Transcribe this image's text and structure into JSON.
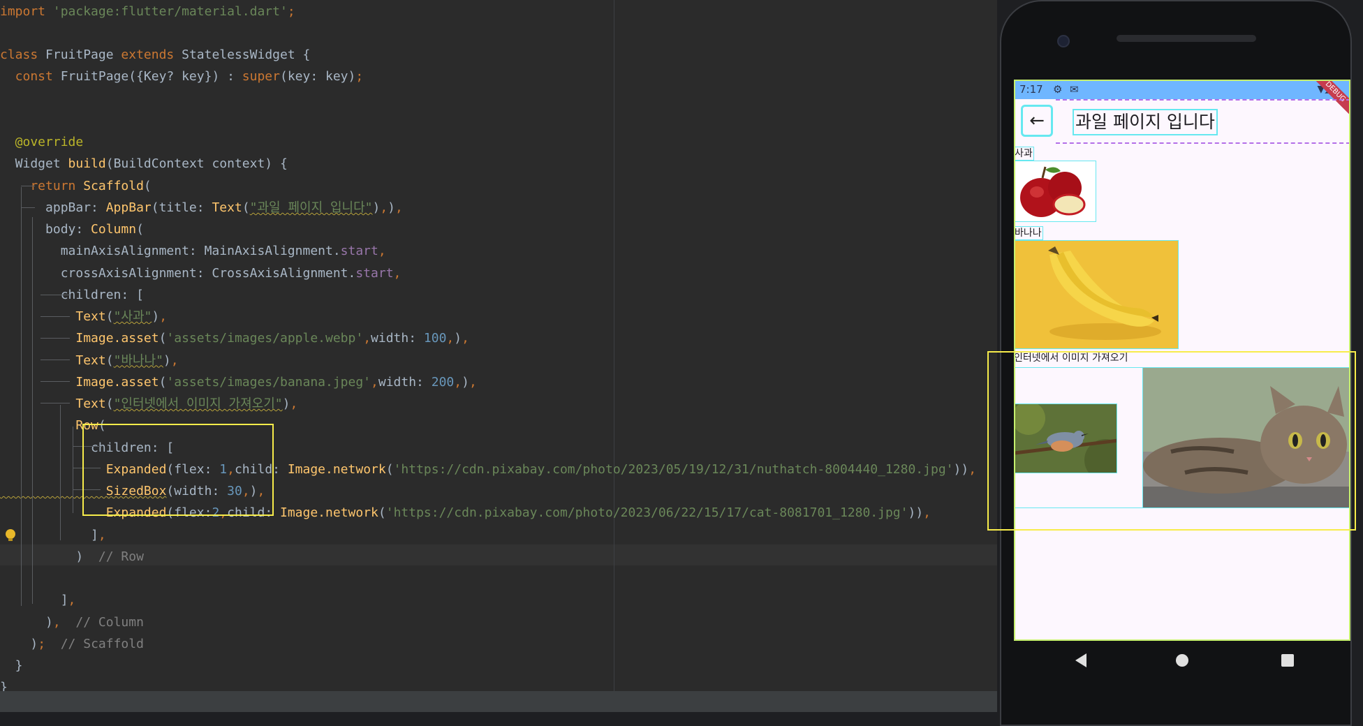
{
  "editor": {
    "lines": [
      {
        "segments": [
          [
            "kw",
            "import "
          ],
          [
            "str",
            "'package:flutter/material.dart'"
          ],
          [
            "kw",
            ";"
          ]
        ]
      },
      {
        "segments": []
      },
      {
        "segments": [
          [
            "kw",
            "class "
          ],
          [
            "cls",
            "FruitPage "
          ],
          [
            "kw",
            "extends "
          ],
          [
            "cls",
            "StatelessWidget {"
          ]
        ]
      },
      {
        "segments": [
          [
            "kw",
            "  const "
          ],
          [
            "cls",
            "FruitPage({Key? key}) : "
          ],
          [
            "kw",
            "super"
          ],
          [
            "cls",
            "(key: key)"
          ],
          [
            "kw",
            ";"
          ]
        ]
      },
      {
        "segments": []
      },
      {
        "segments": [
          [
            "anno",
            "  @override"
          ]
        ]
      },
      {
        "segments": [
          [
            "cls",
            "  Widget "
          ],
          [
            "call",
            "build"
          ],
          [
            "cls",
            "(BuildContext context) {"
          ]
        ]
      },
      {
        "segments": [
          [
            "kw",
            "    return "
          ],
          [
            "call",
            "Scaffold"
          ],
          [
            "cls",
            "("
          ]
        ]
      },
      {
        "segments": [
          [
            "cls",
            "      appBar: "
          ],
          [
            "call",
            "AppBar"
          ],
          [
            "cls",
            "(title: "
          ],
          [
            "call",
            "Text"
          ],
          [
            "cls",
            "("
          ],
          [
            "str",
            "\"과일 페이지 입니다\""
          ],
          [
            "cls",
            ")"
          ],
          [
            "kw",
            ","
          ],
          [
            "cls",
            ")"
          ],
          [
            "kw",
            ","
          ]
        ]
      },
      {
        "segments": [
          [
            "cls",
            "      body: "
          ],
          [
            "call",
            "Column"
          ],
          [
            "cls",
            "("
          ]
        ]
      },
      {
        "segments": [
          [
            "cls",
            "        mainAxisAlignment: MainAxisAlignment."
          ],
          [
            "prop",
            "start"
          ],
          [
            "kw",
            ","
          ]
        ]
      },
      {
        "segments": [
          [
            "cls",
            "        crossAxisAlignment: CrossAxisAlignment."
          ],
          [
            "prop",
            "start"
          ],
          [
            "kw",
            ","
          ]
        ]
      },
      {
        "segments": [
          [
            "cls",
            "        children: ["
          ]
        ]
      },
      {
        "segments": [
          [
            "call",
            "          Text"
          ],
          [
            "cls",
            "("
          ],
          [
            "str",
            "\"사과\""
          ],
          [
            "cls",
            ")"
          ],
          [
            "kw",
            ","
          ]
        ]
      },
      {
        "segments": [
          [
            "call",
            "          Image.asset"
          ],
          [
            "cls",
            "("
          ],
          [
            "str",
            "'assets/images/apple.webp'"
          ],
          [
            "kw",
            ","
          ],
          [
            "cls",
            "width: "
          ],
          [
            "num",
            "100"
          ],
          [
            "kw",
            ","
          ],
          [
            "cls",
            ")"
          ],
          [
            "kw",
            ","
          ]
        ]
      },
      {
        "segments": [
          [
            "call",
            "          Text"
          ],
          [
            "cls",
            "("
          ],
          [
            "str",
            "\"바나나\""
          ],
          [
            "cls",
            ")"
          ],
          [
            "kw",
            ","
          ]
        ]
      },
      {
        "segments": [
          [
            "call",
            "          Image.asset"
          ],
          [
            "cls",
            "("
          ],
          [
            "str",
            "'assets/images/banana.jpeg'"
          ],
          [
            "kw",
            ","
          ],
          [
            "cls",
            "width: "
          ],
          [
            "num",
            "200"
          ],
          [
            "kw",
            ","
          ],
          [
            "cls",
            ")"
          ],
          [
            "kw",
            ","
          ]
        ]
      },
      {
        "segments": [
          [
            "call",
            "          Text"
          ],
          [
            "cls",
            "("
          ],
          [
            "str",
            "\"인터넷에서 이미지 가져오기\""
          ],
          [
            "cls",
            ")"
          ],
          [
            "kw",
            ","
          ]
        ]
      },
      {
        "segments": [
          [
            "call",
            "          Row"
          ],
          [
            "cls",
            "("
          ]
        ]
      },
      {
        "segments": [
          [
            "cls",
            "            children: ["
          ]
        ]
      },
      {
        "segments": [
          [
            "call",
            "              Expanded"
          ],
          [
            "cls",
            "(flex: "
          ],
          [
            "num",
            "1"
          ],
          [
            "kw",
            ","
          ],
          [
            "cls",
            "child: "
          ],
          [
            "call",
            "Image.network"
          ],
          [
            "cls",
            "("
          ],
          [
            "str",
            "'https://cdn.pixabay.com/photo/2023/05/19/12/31/nuthatch-8004440_1280.jpg'"
          ],
          [
            "cls",
            "))"
          ],
          [
            "kw",
            ","
          ]
        ]
      },
      {
        "segments": [
          [
            "call",
            "              SizedBox"
          ],
          [
            "cls",
            "(width: "
          ],
          [
            "num",
            "30"
          ],
          [
            "kw",
            ","
          ],
          [
            "cls",
            ")"
          ],
          [
            "kw",
            ","
          ]
        ]
      },
      {
        "segments": [
          [
            "call",
            "              Expanded"
          ],
          [
            "cls",
            "(flex:"
          ],
          [
            "num",
            "2"
          ],
          [
            "kw",
            ","
          ],
          [
            "cls",
            "child: "
          ],
          [
            "call",
            "Image.network"
          ],
          [
            "cls",
            "("
          ],
          [
            "str",
            "'https://cdn.pixabay.com/photo/2023/06/22/15/17/cat-8081701_1280.jpg'"
          ],
          [
            "cls",
            "))"
          ],
          [
            "kw",
            ","
          ]
        ]
      },
      {
        "segments": [
          [
            "cls",
            "            ]"
          ],
          [
            "kw",
            ","
          ]
        ]
      },
      {
        "segments": [
          [
            "cls",
            "          )  "
          ],
          [
            "cmt",
            "// Row"
          ]
        ]
      },
      {
        "segments": []
      },
      {
        "segments": [
          [
            "cls",
            "        ]"
          ],
          [
            "kw",
            ","
          ]
        ]
      },
      {
        "segments": [
          [
            "cls",
            "      )"
          ],
          [
            "kw",
            ","
          ],
          [
            "cls",
            "  "
          ],
          [
            "cmt",
            "// Column"
          ]
        ]
      },
      {
        "segments": [
          [
            "cls",
            "    )"
          ],
          [
            "kw",
            ";"
          ],
          [
            "cls",
            "  "
          ],
          [
            "cmt",
            "// Scaffold"
          ]
        ]
      },
      {
        "segments": [
          [
            "cls",
            "  }"
          ]
        ]
      },
      {
        "segments": [
          [
            "cls",
            "}"
          ]
        ]
      }
    ]
  },
  "phone": {
    "status": {
      "time": "7:17",
      "settings_icon": "gear-icon",
      "mail_icon": "mail-icon",
      "right_icons": "wifi-icon signal-icon battery-icon"
    },
    "debug_banner": "DEBUG",
    "appbar": {
      "back_icon": "←",
      "title": "과일 페이지 입니다"
    },
    "body": {
      "apple_label": "사과",
      "banana_label": "바나나",
      "network_label": "인터넷에서 이미지 가져오기"
    }
  },
  "colors": {
    "accent": "#6fb6ff",
    "inspect": "#f7ec4a",
    "outline": "#66e8f0"
  }
}
